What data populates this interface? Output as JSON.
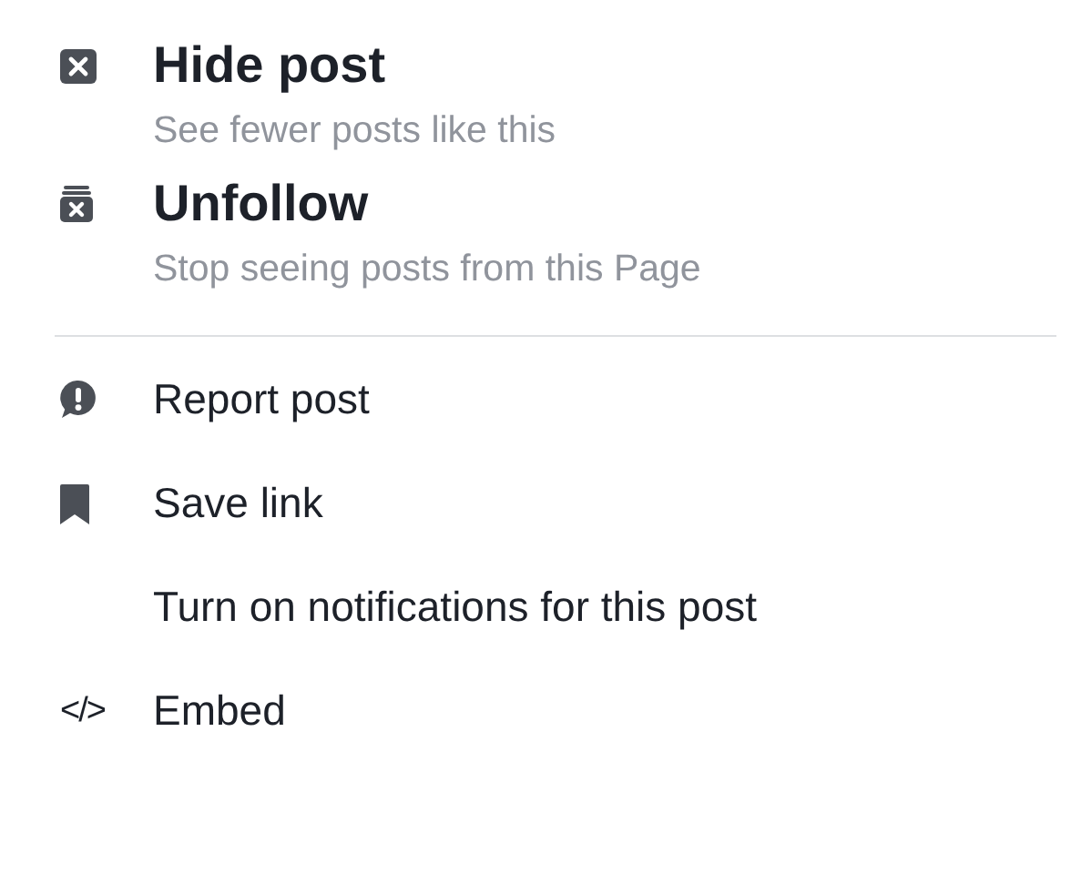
{
  "primary_items": [
    {
      "kind": "hide",
      "title": "Hide post",
      "subtitle": "See fewer posts like this"
    },
    {
      "kind": "unfollow",
      "title": "Unfollow",
      "subtitle": "Stop seeing posts from this Page"
    }
  ],
  "secondary_items": [
    {
      "kind": "report",
      "label": "Report post"
    },
    {
      "kind": "bookmark",
      "label": "Save link"
    },
    {
      "kind": "plain",
      "label": "Turn on notifications for this post"
    },
    {
      "kind": "glyph",
      "glyph": "</>",
      "label": "Embed"
    }
  ]
}
